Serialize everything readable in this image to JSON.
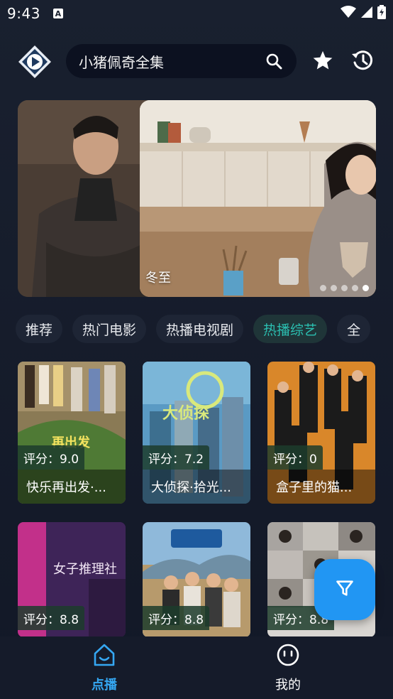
{
  "status_bar": {
    "time": "9:43",
    "notification_badge": "A",
    "icons": [
      "wifi-icon",
      "signal-icon",
      "battery-icon"
    ]
  },
  "header": {
    "logo_icon": "play-logo-icon",
    "search_value": "小猪佩奇全集",
    "search_icon": "search-icon",
    "favorites_icon": "star-icon",
    "history_icon": "history-icon"
  },
  "banner": {
    "caption": "冬至",
    "slide_count": 5,
    "active_slide": 5
  },
  "tabs": [
    {
      "label": "推荐",
      "active": false
    },
    {
      "label": "热门电影",
      "active": false
    },
    {
      "label": "热播电视剧",
      "active": false
    },
    {
      "label": "热播综艺",
      "active": true
    },
    {
      "label": "全",
      "active": false
    }
  ],
  "cards": [
    {
      "score": "评分：9.0",
      "title": "快乐再出发·..."
    },
    {
      "score": "评分：7.2",
      "title": "大侦探·拾光..."
    },
    {
      "score": "评分：0",
      "title": "盒子里的猫..."
    },
    {
      "score": "评分：8.8",
      "title": ""
    },
    {
      "score": "评分：8.8",
      "title": ""
    },
    {
      "score": "评分：8.8",
      "title": ""
    }
  ],
  "fab": {
    "icon": "filter-icon"
  },
  "bottom_nav": {
    "home_label": "点播",
    "mine_label": "我的",
    "active": "home"
  },
  "colors": {
    "accent": "#2bbfb1",
    "nav_active": "#35a7f2",
    "fab": "#2196f3",
    "background": "#141a29"
  }
}
